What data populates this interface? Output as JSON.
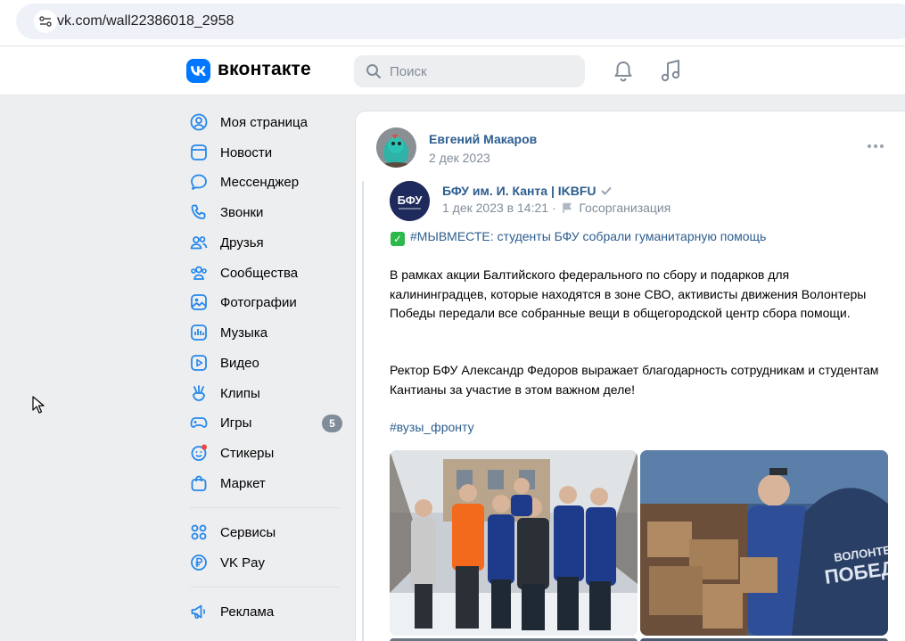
{
  "browser": {
    "url": "vk.com/wall22386018_2958"
  },
  "header": {
    "logo_letter": "VK",
    "wordmark": "вконтакте",
    "search_placeholder": "Поиск",
    "accent_color": "#0077ff"
  },
  "sidebar": {
    "items": [
      {
        "label": "Моя страница",
        "icon": "profile-icon"
      },
      {
        "label": "Новости",
        "icon": "news-icon"
      },
      {
        "label": "Мессенджер",
        "icon": "messenger-icon"
      },
      {
        "label": "Звонки",
        "icon": "phone-icon"
      },
      {
        "label": "Друзья",
        "icon": "friends-icon"
      },
      {
        "label": "Сообщества",
        "icon": "communities-icon"
      },
      {
        "label": "Фотографии",
        "icon": "photos-icon"
      },
      {
        "label": "Музыка",
        "icon": "music-icon"
      },
      {
        "label": "Видео",
        "icon": "video-icon"
      },
      {
        "label": "Клипы",
        "icon": "clips-icon"
      },
      {
        "label": "Игры",
        "icon": "games-icon",
        "badge": "5"
      },
      {
        "label": "Стикеры",
        "icon": "stickers-icon"
      },
      {
        "label": "Маркет",
        "icon": "market-icon"
      }
    ],
    "secondary_items": [
      {
        "label": "Сервисы",
        "icon": "services-icon"
      },
      {
        "label": "VK Pay",
        "icon": "vkpay-icon"
      }
    ],
    "tertiary_items": [
      {
        "label": "Реклама",
        "icon": "ads-icon"
      }
    ]
  },
  "post": {
    "author_name": "Евгений Макаров",
    "date": "2 дек 2023",
    "repost": {
      "source_name": "БФУ им. И. Канта | IKBFU",
      "source_avatar_text": "БФУ",
      "source_date": "1 дек 2023 в 14:21",
      "separator": "·",
      "source_type": "Госорганизация",
      "headline": "#МЫВМЕСТЕ: студенты БФУ собрали гуманитарную помощь",
      "paragraph_1": "В рамках акции Балтийского федерального по сбору и подарков для калининградцев, которые находятся в зоне СВО, активисты движения Волонтеры Победы передали все собранные вещи в общегородской центр сбора помощи.",
      "paragraph_2": "Ректор БФУ Александр Федоров выражает благодарность сотрудникам и студентам Кантианы за участие в этом важном деле!",
      "hashtag": "#вузы_фронту"
    }
  }
}
